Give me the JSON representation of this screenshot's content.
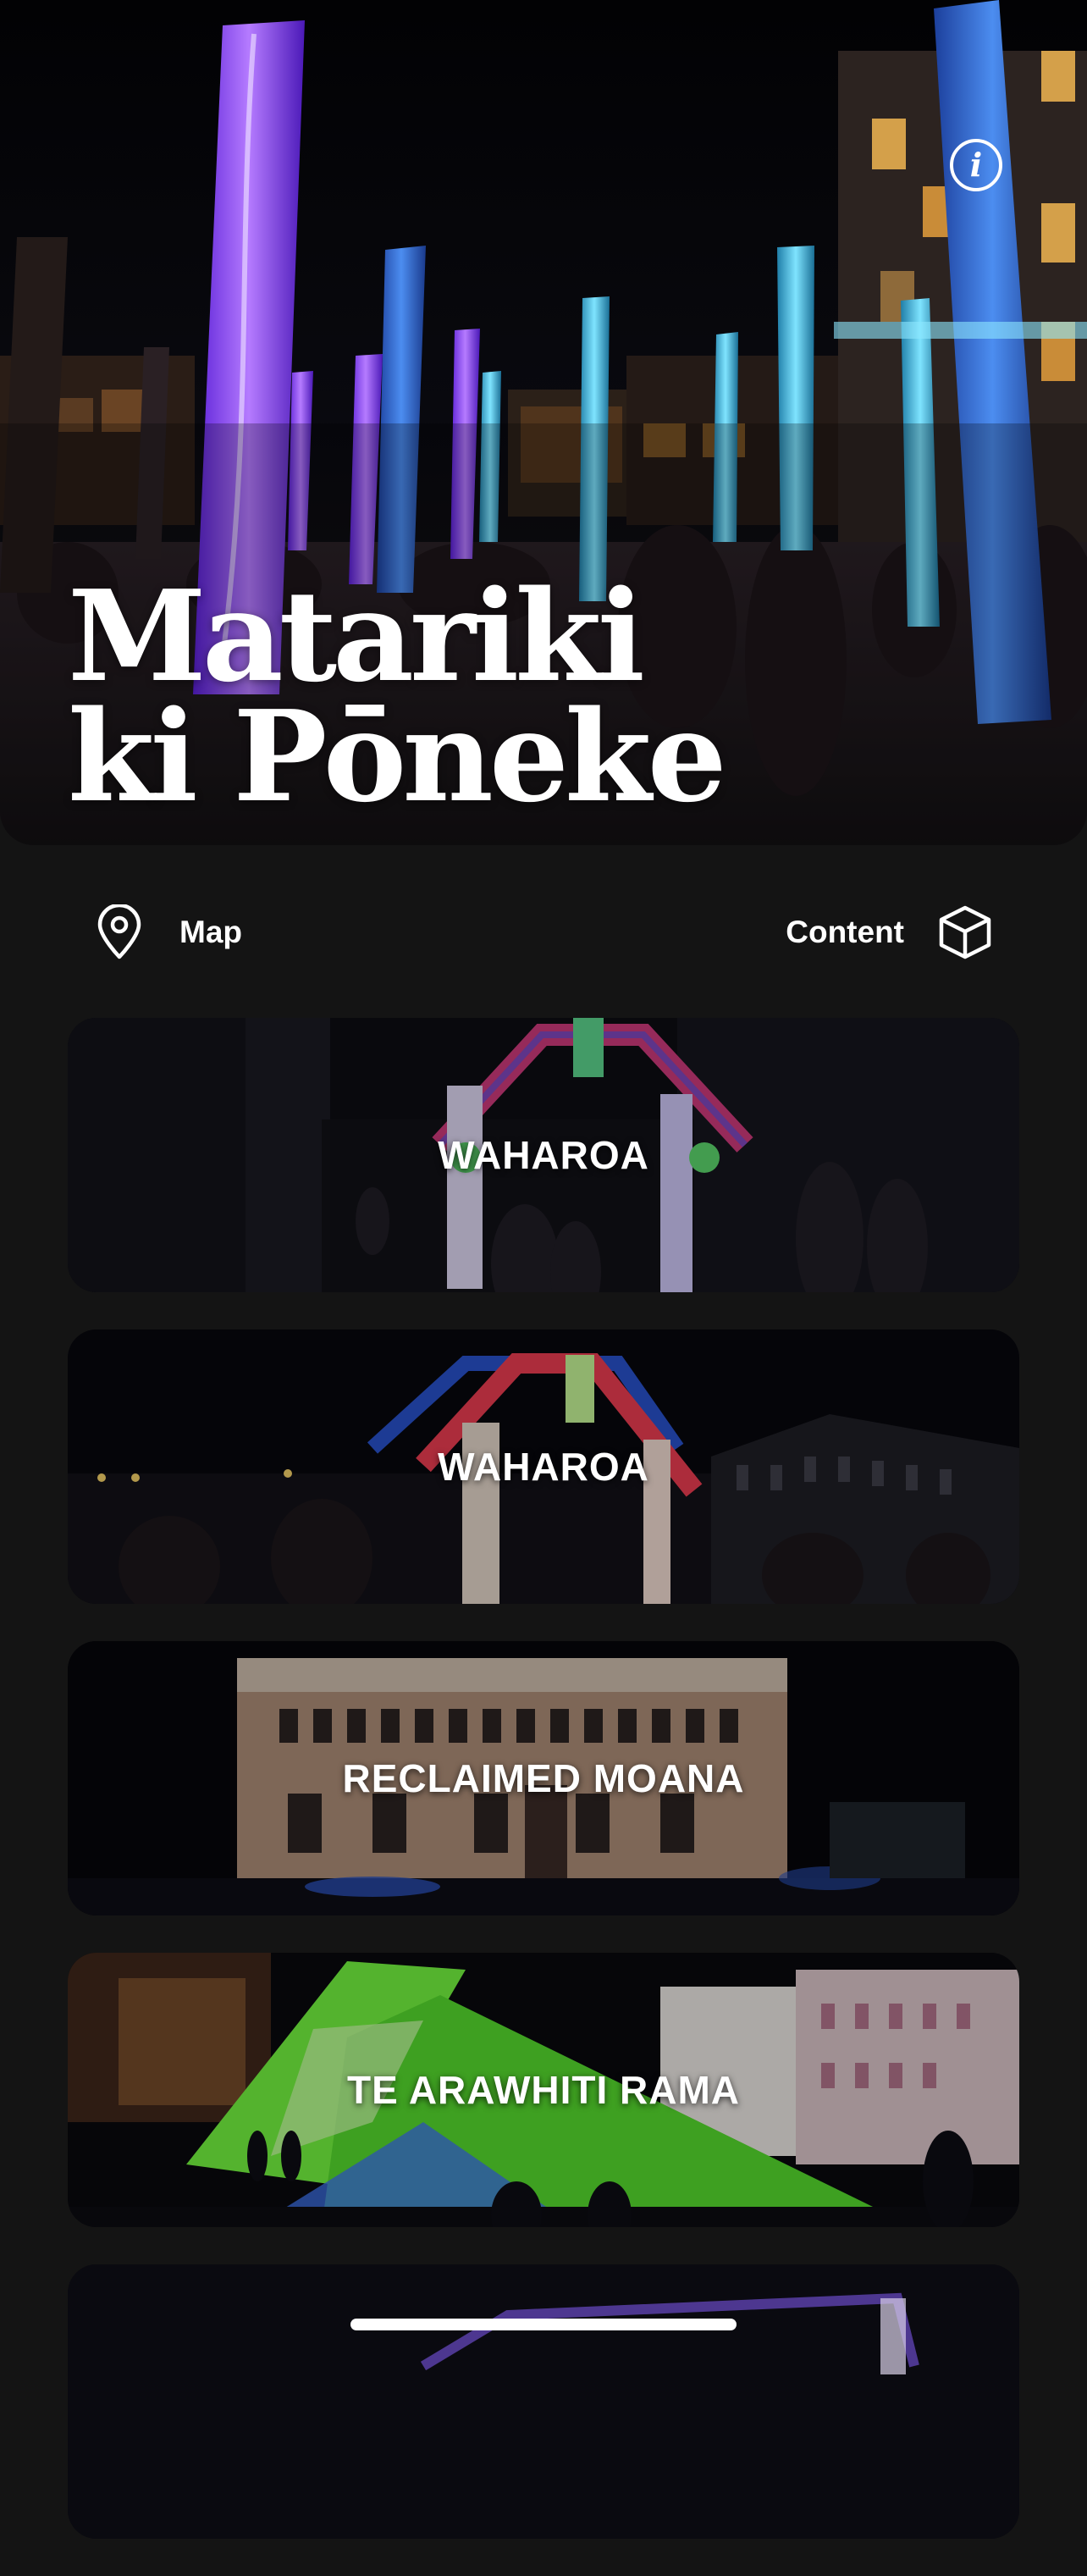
{
  "hero": {
    "title_line1": "Matariki",
    "title_line2": "ki Pōneke",
    "info_icon": "info-icon",
    "info_glyph": "i"
  },
  "nav": {
    "map_label": "Map",
    "map_icon": "location-pin-icon",
    "content_label": "Content",
    "content_icon": "cube-icon"
  },
  "cards": [
    {
      "title": "WAHAROA"
    },
    {
      "title": "WAHAROA"
    },
    {
      "title": "RECLAIMED MOANA"
    },
    {
      "title": "TE ARAWHITI RAMA"
    },
    {
      "title": ""
    }
  ],
  "colors": {
    "background": "#141414",
    "text": "#ffffff",
    "pillar_purple": "#8a3cff",
    "pillar_cyan": "#3fc6e6",
    "projection_green": "#4ee22a"
  }
}
